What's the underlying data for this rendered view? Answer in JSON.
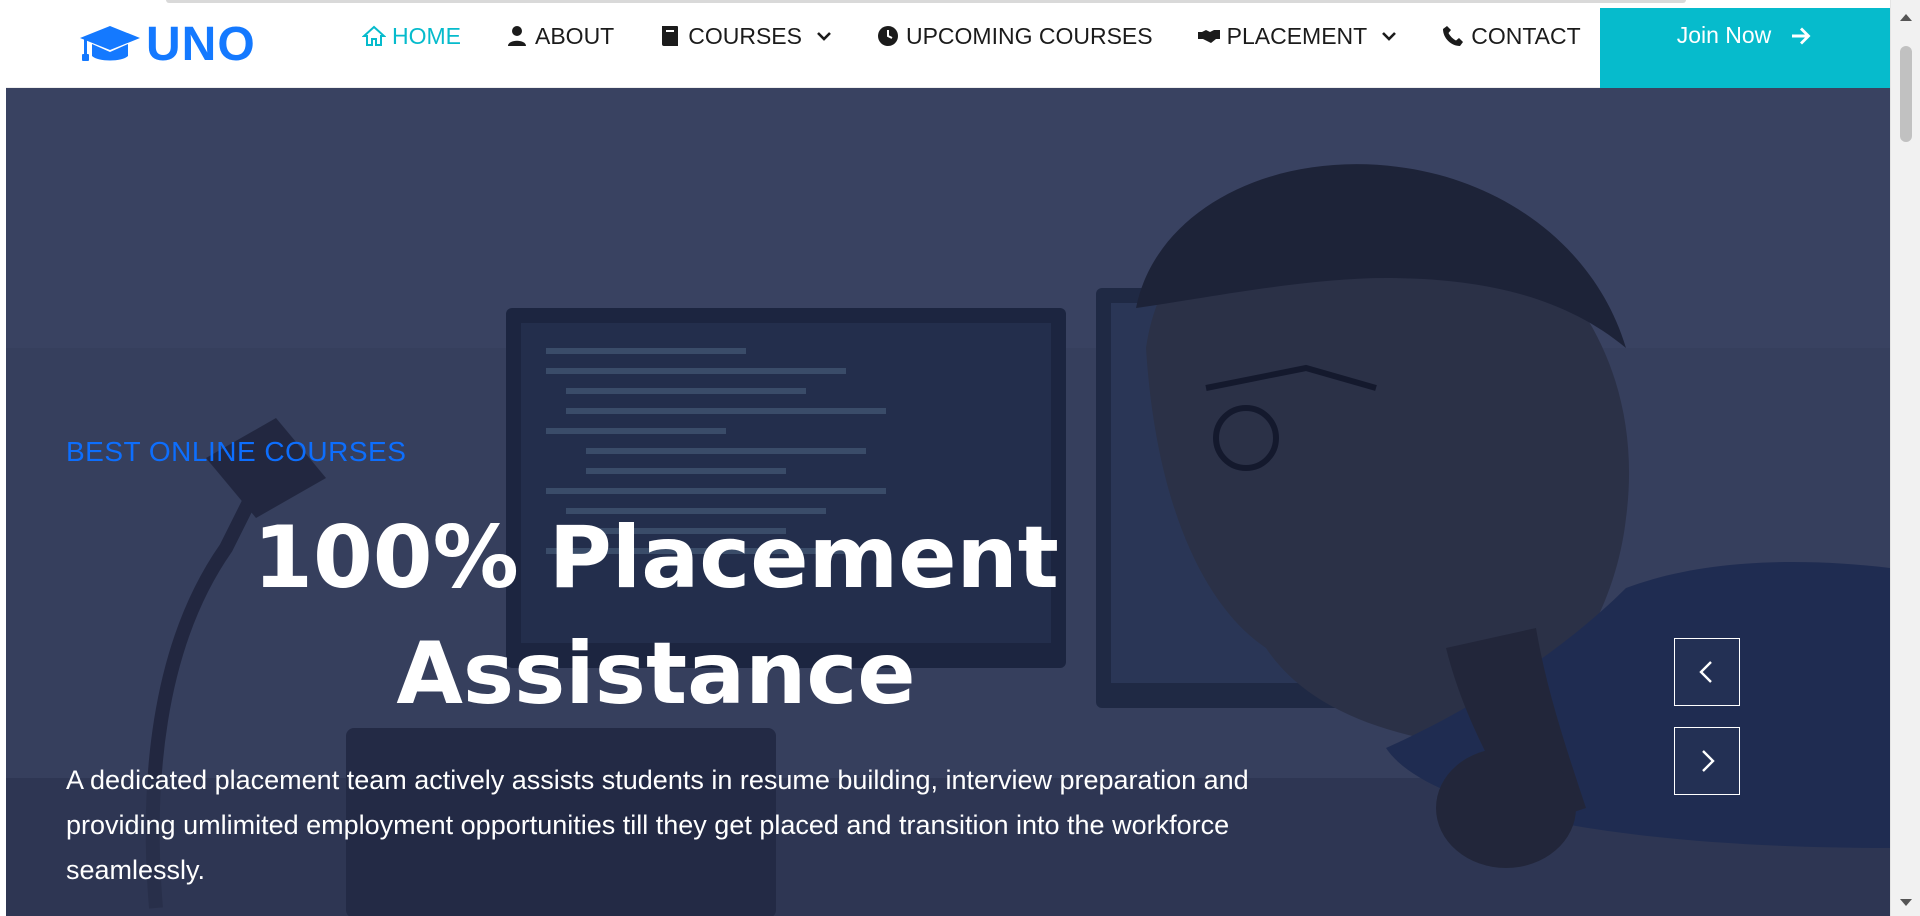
{
  "brand": {
    "name": "UNO",
    "accent_color": "#06bbcc",
    "logo_color": "#1479ff"
  },
  "nav": {
    "items": [
      {
        "label": "HOME",
        "icon": "home-icon",
        "active": true
      },
      {
        "label": "ABOUT",
        "icon": "user-icon",
        "active": false
      },
      {
        "label": "COURSES",
        "icon": "book-icon",
        "active": false,
        "dropdown": true
      },
      {
        "label": "UPCOMING COURSES",
        "icon": "clock-icon",
        "active": false
      },
      {
        "label": "PLACEMENT",
        "icon": "handshake-icon",
        "active": false,
        "dropdown": true
      },
      {
        "label": "CONTACT",
        "icon": "phone-icon",
        "active": false
      }
    ],
    "cta_label": "Join Now"
  },
  "hero": {
    "eyebrow": "BEST ONLINE COURSES",
    "title_line1": "100% Placement",
    "title_line2": "Assistance",
    "description": "A dedicated placement team actively assists students in resume building, interview preparation and providing umlimited employment opportunities till they get placed and transition into the workforce seamlessly.",
    "prev_icon": "chevron-left-icon",
    "next_icon": "chevron-right-icon"
  }
}
